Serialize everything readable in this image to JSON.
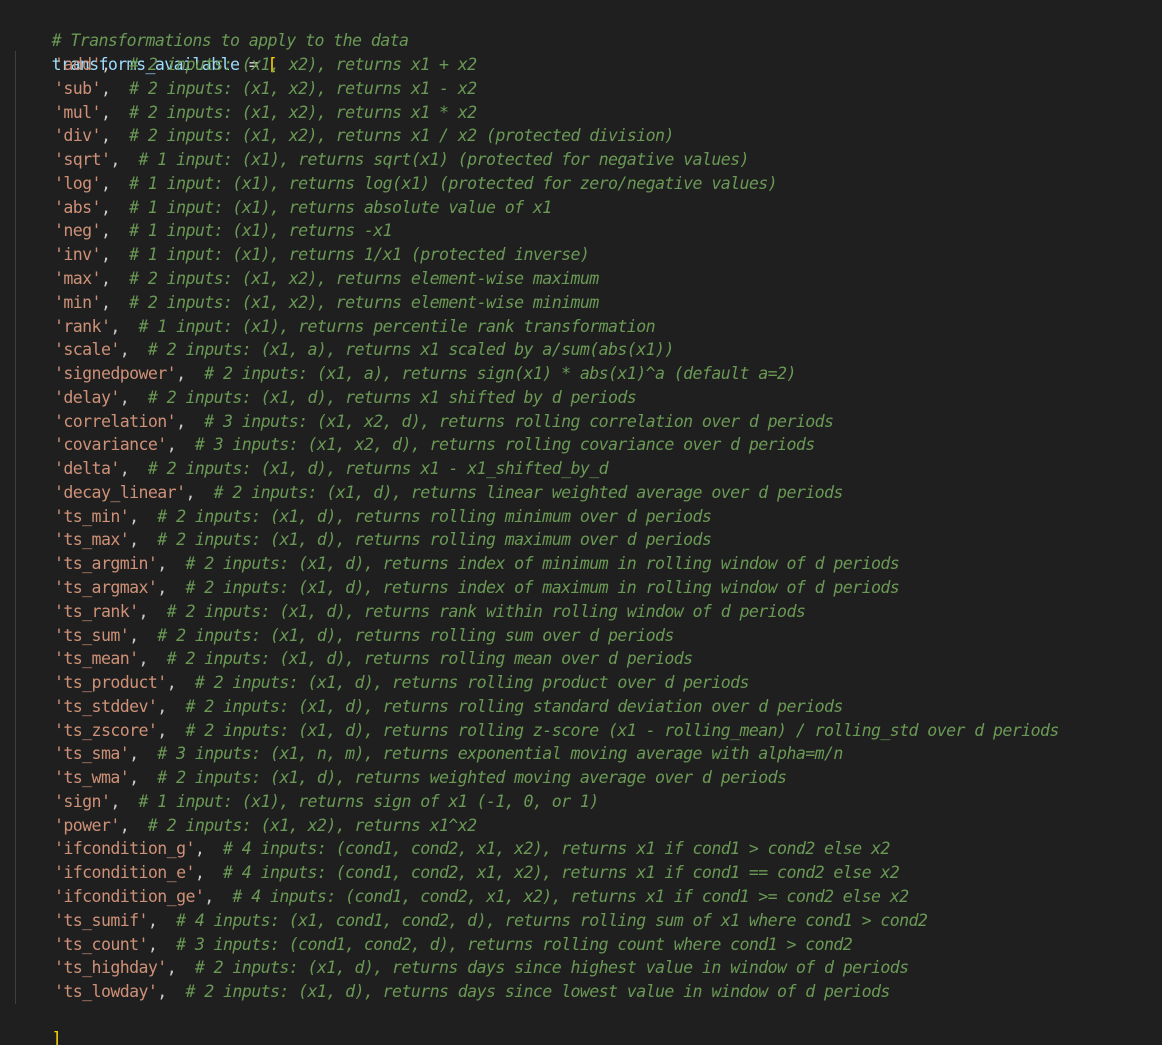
{
  "header_comment": "# Transformations to apply to the data",
  "assignment": {
    "variable": "transforms_available",
    "operator": " = ",
    "open_bracket": "[",
    "close_bracket": "]"
  },
  "items": [
    {
      "name": "'add'",
      "comment": "# 2 inputs: (x1, x2), returns x1 + x2"
    },
    {
      "name": "'sub'",
      "comment": "# 2 inputs: (x1, x2), returns x1 - x2"
    },
    {
      "name": "'mul'",
      "comment": "# 2 inputs: (x1, x2), returns x1 * x2"
    },
    {
      "name": "'div'",
      "comment": "# 2 inputs: (x1, x2), returns x1 / x2 (protected division)"
    },
    {
      "name": "'sqrt'",
      "comment": "# 1 input: (x1), returns sqrt(x1) (protected for negative values)"
    },
    {
      "name": "'log'",
      "comment": "# 1 input: (x1), returns log(x1) (protected for zero/negative values)"
    },
    {
      "name": "'abs'",
      "comment": "# 1 input: (x1), returns absolute value of x1"
    },
    {
      "name": "'neg'",
      "comment": "# 1 input: (x1), returns -x1"
    },
    {
      "name": "'inv'",
      "comment": "# 1 input: (x1), returns 1/x1 (protected inverse)"
    },
    {
      "name": "'max'",
      "comment": "# 2 inputs: (x1, x2), returns element-wise maximum"
    },
    {
      "name": "'min'",
      "comment": "# 2 inputs: (x1, x2), returns element-wise minimum"
    },
    {
      "name": "'rank'",
      "comment": "# 1 input: (x1), returns percentile rank transformation"
    },
    {
      "name": "'scale'",
      "comment": "# 2 inputs: (x1, a), returns x1 scaled by a/sum(abs(x1))"
    },
    {
      "name": "'signedpower'",
      "comment": "# 2 inputs: (x1, a), returns sign(x1) * abs(x1)^a (default a=2)"
    },
    {
      "name": "'delay'",
      "comment": "# 2 inputs: (x1, d), returns x1 shifted by d periods"
    },
    {
      "name": "'correlation'",
      "comment": "# 3 inputs: (x1, x2, d), returns rolling correlation over d periods"
    },
    {
      "name": "'covariance'",
      "comment": "# 3 inputs: (x1, x2, d), returns rolling covariance over d periods"
    },
    {
      "name": "'delta'",
      "comment": "# 2 inputs: (x1, d), returns x1 - x1_shifted_by_d"
    },
    {
      "name": "'decay_linear'",
      "comment": "# 2 inputs: (x1, d), returns linear weighted average over d periods"
    },
    {
      "name": "'ts_min'",
      "comment": "# 2 inputs: (x1, d), returns rolling minimum over d periods"
    },
    {
      "name": "'ts_max'",
      "comment": "# 2 inputs: (x1, d), returns rolling maximum over d periods"
    },
    {
      "name": "'ts_argmin'",
      "comment": "# 2 inputs: (x1, d), returns index of minimum in rolling window of d periods"
    },
    {
      "name": "'ts_argmax'",
      "comment": "# 2 inputs: (x1, d), returns index of maximum in rolling window of d periods"
    },
    {
      "name": "'ts_rank'",
      "comment": "# 2 inputs: (x1, d), returns rank within rolling window of d periods"
    },
    {
      "name": "'ts_sum'",
      "comment": "# 2 inputs: (x1, d), returns rolling sum over d periods"
    },
    {
      "name": "'ts_mean'",
      "comment": "# 2 inputs: (x1, d), returns rolling mean over d periods"
    },
    {
      "name": "'ts_product'",
      "comment": "# 2 inputs: (x1, d), returns rolling product over d periods"
    },
    {
      "name": "'ts_stddev'",
      "comment": "# 2 inputs: (x1, d), returns rolling standard deviation over d periods"
    },
    {
      "name": "'ts_zscore'",
      "comment": "# 2 inputs: (x1, d), returns rolling z-score (x1 - rolling_mean) / rolling_std over d periods"
    },
    {
      "name": "'ts_sma'",
      "comment": "# 3 inputs: (x1, n, m), returns exponential moving average with alpha=m/n"
    },
    {
      "name": "'ts_wma'",
      "comment": "# 2 inputs: (x1, d), returns weighted moving average over d periods"
    },
    {
      "name": "'sign'",
      "comment": "# 1 input: (x1), returns sign of x1 (-1, 0, or 1)"
    },
    {
      "name": "'power'",
      "comment": "# 2 inputs: (x1, x2), returns x1^x2"
    },
    {
      "name": "'ifcondition_g'",
      "comment": "# 4 inputs: (cond1, cond2, x1, x2), returns x1 if cond1 > cond2 else x2"
    },
    {
      "name": "'ifcondition_e'",
      "comment": "# 4 inputs: (cond1, cond2, x1, x2), returns x1 if cond1 == cond2 else x2"
    },
    {
      "name": "'ifcondition_ge'",
      "comment": "# 4 inputs: (cond1, cond2, x1, x2), returns x1 if cond1 >= cond2 else x2"
    },
    {
      "name": "'ts_sumif'",
      "comment": "# 4 inputs: (x1, cond1, cond2, d), returns rolling sum of x1 where cond1 > cond2"
    },
    {
      "name": "'ts_count'",
      "comment": "# 3 inputs: (cond1, cond2, d), returns rolling count where cond1 > cond2"
    },
    {
      "name": "'ts_highday'",
      "comment": "# 2 inputs: (x1, d), returns days since highest value in window of d periods"
    },
    {
      "name": "'ts_lowday'",
      "comment": "# 2 inputs: (x1, d), returns days since lowest value in window of d periods"
    }
  ]
}
